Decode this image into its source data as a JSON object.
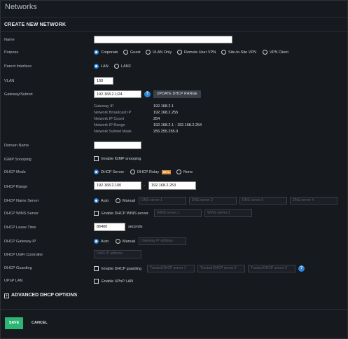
{
  "page": {
    "title": "Networks"
  },
  "section": {
    "title": "CREATE NEW NETWORK"
  },
  "fields": {
    "name": {
      "label": "Name",
      "value": ""
    },
    "purpose": {
      "label": "Purpose",
      "options": [
        "Corporate",
        "Guest",
        "VLAN Only",
        "Remote User VPN",
        "Site-to-Site VPN",
        "VPN Client"
      ],
      "selected": "Corporate"
    },
    "parent_interface": {
      "label": "Parent Interface",
      "options": [
        "LAN",
        "LAN2"
      ],
      "selected": "LAN"
    },
    "vlan": {
      "label": "VLAN",
      "value": "100"
    },
    "gateway_subnet": {
      "label": "Gateway/Subnet",
      "value": "192.168.2.1/24",
      "help_icon": "question-icon",
      "button": "UPDATE DHCP RANGE"
    },
    "subnet_info": [
      {
        "label": "Gateway IP",
        "value": "192.168.2.1"
      },
      {
        "label": "Network Broadcast IP",
        "value": "192.168.2.255"
      },
      {
        "label": "Network IP Count",
        "value": "254"
      },
      {
        "label": "Network IP Range",
        "value": "192.168.2.1 - 192.168.2.254"
      },
      {
        "label": "Network Subnet Mask",
        "value": "255.255.255.0"
      }
    ],
    "domain_name": {
      "label": "Domain Name",
      "value": ""
    },
    "igmp_snooping": {
      "label": "IGMP Snooping",
      "check_label": "Enable IGMP snooping",
      "checked": false
    },
    "dhcp_mode": {
      "label": "DHCP Mode",
      "options": [
        "DHCP Server",
        "DHCP Relay",
        "None"
      ],
      "selected": "DHCP Server",
      "beta": "BETA"
    },
    "dhcp_range": {
      "label": "DHCP Range",
      "start": "192.168.2.100",
      "separator": "-",
      "end": "192.168.2.253"
    },
    "dhcp_name_server": {
      "label": "DHCP Name Server",
      "options": [
        "Auto",
        "Manual"
      ],
      "selected": "Auto",
      "placeholders": [
        "DNS server 1",
        "DNS server 2",
        "DNS server 3",
        "DNS server 4"
      ]
    },
    "dhcp_wins_server": {
      "label": "DHCP WINS Server",
      "check_label": "Enable DHCP WINS server",
      "checked": false,
      "placeholders": [
        "WINS server 1",
        "WINS server 2"
      ]
    },
    "dhcp_lease_time": {
      "label": "DHCP Lease Time",
      "value": "86400",
      "unit": "seconds"
    },
    "dhcp_gateway_ip": {
      "label": "DHCP Gateway IP",
      "options": [
        "Auto",
        "Manual"
      ],
      "selected": "Auto",
      "placeholder": "Gateway IP address"
    },
    "dhcp_unifi_controller": {
      "label": "DHCP UniFi Controller",
      "placeholder": "UniFi IP address"
    },
    "dhcp_guarding": {
      "label": "DHCP Guarding",
      "check_label": "Enable DHCP guarding",
      "checked": false,
      "placeholders": [
        "Trusted DHCP server 1",
        "Trusted DHCP server 2",
        "Trusted DHCP server 3"
      ],
      "help_icon": "question-icon"
    },
    "upnp_lan": {
      "label": "UPnP LAN",
      "check_label": "Enable UPnP LAN",
      "checked": false
    }
  },
  "advanced": {
    "label": "ADVANCED DHCP OPTIONS",
    "icon": "plus-box-icon"
  },
  "footer": {
    "save": "SAVE",
    "cancel": "CANCEL"
  },
  "colors": {
    "accent": "#2f86d9",
    "save": "#2bb673",
    "background": "#16191e",
    "beta": "#d9893a"
  }
}
